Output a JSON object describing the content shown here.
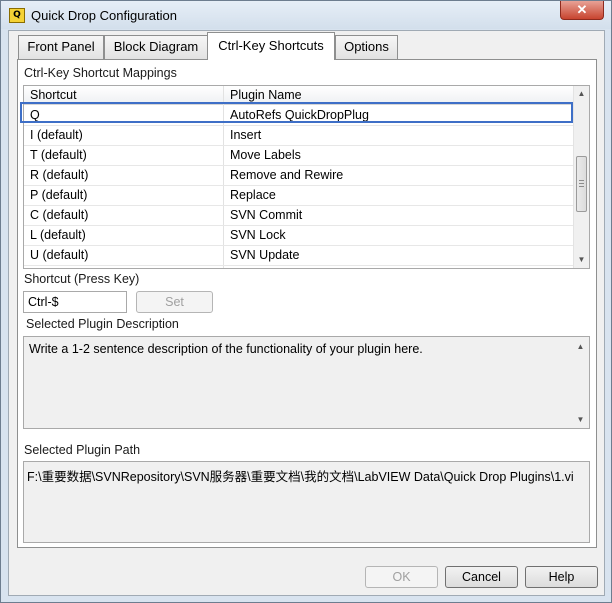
{
  "window": {
    "title": "Quick Drop Configuration",
    "app_icon_text": "Q",
    "close_glyph": "✕"
  },
  "tabs": [
    {
      "label": "Front Panel",
      "active": false
    },
    {
      "label": "Block Diagram",
      "active": false
    },
    {
      "label": "Ctrl-Key Shortcuts",
      "active": true
    },
    {
      "label": "Options",
      "active": false
    }
  ],
  "mappings": {
    "section_label": "Ctrl-Key Shortcut Mappings",
    "columns": [
      "Shortcut",
      "Plugin Name"
    ],
    "rows": [
      {
        "shortcut": "Q",
        "plugin": "AutoRefs QuickDropPlug"
      },
      {
        "shortcut": "I (default)",
        "plugin": "Insert"
      },
      {
        "shortcut": "T (default)",
        "plugin": "Move Labels"
      },
      {
        "shortcut": "R (default)",
        "plugin": "Remove and Rewire"
      },
      {
        "shortcut": "P (default)",
        "plugin": "Replace"
      },
      {
        "shortcut": "C (default)",
        "plugin": "SVN Commit"
      },
      {
        "shortcut": "L (default)",
        "plugin": "SVN Lock"
      },
      {
        "shortcut": "U (default)",
        "plugin": "SVN Update"
      }
    ],
    "selected_index": 0,
    "highlight_color": "#3e6fc7"
  },
  "shortcut": {
    "label": "Shortcut (Press Key)",
    "value": "Ctrl-$",
    "set_label": "Set"
  },
  "description": {
    "label": "Selected Plugin Description",
    "text": "Write a 1-2 sentence description of the functionality of your plugin here."
  },
  "path": {
    "label": "Selected Plugin Path",
    "text": "F:\\重要数据\\SVNRepository\\SVN服务器\\重要文档\\我的文档\\LabVIEW Data\\Quick Drop Plugins\\1.vi"
  },
  "footer": {
    "ok_label": "OK",
    "cancel_label": "Cancel",
    "help_label": "Help"
  },
  "icons": {
    "scroll_up": "up-arrow-icon",
    "scroll_down": "down-arrow-icon",
    "window_close": "close-icon"
  }
}
